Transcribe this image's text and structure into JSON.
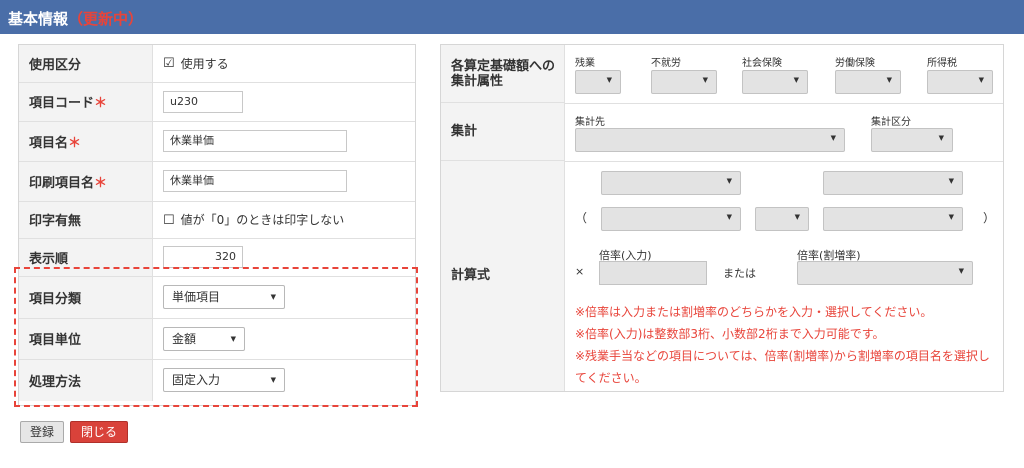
{
  "header": {
    "title": "基本情報",
    "status": "（更新中）"
  },
  "left": {
    "usage": {
      "label": "使用区分",
      "checkbox": "☑",
      "text": "使用する"
    },
    "code": {
      "label": "項目コード",
      "value": "u230"
    },
    "name": {
      "label": "項目名",
      "value": "休業単価"
    },
    "print_name": {
      "label": "印刷項目名",
      "value": "休業単価"
    },
    "print_flag": {
      "label": "印字有無",
      "checkbox": "☐",
      "text": "値が「0」のときは印字しない"
    },
    "order": {
      "label": "表示順",
      "value": "320"
    },
    "category": {
      "label": "項目分類",
      "value": "単価項目"
    },
    "unit": {
      "label": "項目単位",
      "value": "金額"
    },
    "method": {
      "label": "処理方法",
      "value": "固定入力"
    },
    "required_mark": "＊"
  },
  "right": {
    "attr": {
      "label": "各算定基礎額への集計属性",
      "columns": [
        "残業",
        "不就労",
        "社会保険",
        "労働保険",
        "所得税"
      ]
    },
    "aggregate": {
      "label": "集計",
      "dest_label": "集計先",
      "cat_label": "集計区分"
    },
    "formula": {
      "label": "計算式",
      "open_paren": "（",
      "close_paren": "）",
      "times": "×",
      "rate_input_label": "倍率(入力)",
      "or_text": "または",
      "rate_markup_label": "倍率(割増率)",
      "notes": [
        "※倍率は入力または割増率のどちらかを入力・選択してください。",
        "※倍率(入力)は整数部3桁、小数部2桁まで入力可能です。",
        "※残業手当などの項目については、倍率(割増率)から割増率の項目名を選択してください。"
      ]
    }
  },
  "buttons": {
    "register": "登録",
    "close": "閉じる"
  },
  "icons": {
    "dropdown_arrow": "▼"
  },
  "colors": {
    "header_bg": "#4a6ea8",
    "accent_red": "#e8443a",
    "label_bg": "#f3f3f3"
  }
}
